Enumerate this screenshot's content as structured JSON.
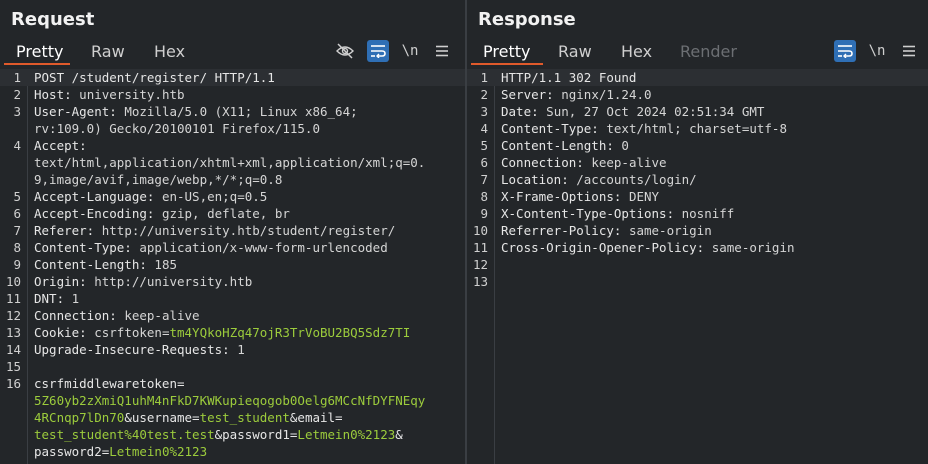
{
  "request": {
    "title": "Request",
    "tabs": [
      "Pretty",
      "Raw",
      "Hex"
    ],
    "lines": [
      {
        "n": "1",
        "k": "POST /student/register/ HTTP/1.1",
        "v": ""
      },
      {
        "n": "2",
        "k": "Host:",
        "v": " university.htb"
      },
      {
        "n": "3",
        "k": "User-Agent:",
        "v": " Mozilla/5.0 (X11; Linux x86_64;"
      },
      {
        "n": "",
        "k": "",
        "v": "rv:109.0) Gecko/20100101 Firefox/115.0"
      },
      {
        "n": "4",
        "k": "Accept:",
        "v": ""
      },
      {
        "n": "",
        "k": "",
        "v": "text/html,application/xhtml+xml,application/xml;q=0."
      },
      {
        "n": "",
        "k": "",
        "v": "9,image/avif,image/webp,*/*;q=0.8"
      },
      {
        "n": "5",
        "k": "Accept-Language:",
        "v": " en-US,en;q=0.5"
      },
      {
        "n": "6",
        "k": "Accept-Encoding:",
        "v": " gzip, deflate, br"
      },
      {
        "n": "7",
        "k": "Referer:",
        "v": " http://university.htb/student/register/"
      },
      {
        "n": "8",
        "k": "Content-Type:",
        "v": " application/x-www-form-urlencoded"
      },
      {
        "n": "9",
        "k": "Content-Length:",
        "v": " 185"
      },
      {
        "n": "10",
        "k": "Origin:",
        "v": " http://university.htb"
      },
      {
        "n": "11",
        "k": "DNT:",
        "v": " 1"
      },
      {
        "n": "12",
        "k": "Connection:",
        "v": " keep-alive"
      },
      {
        "n": "13",
        "k": "Cookie:",
        "v": " csrftoken=",
        "g": "tm4YQkoHZq47ojR3TrVoBU2BQ5Sdz7TI"
      },
      {
        "n": "14",
        "k": "Upgrade-Insecure-Requests:",
        "v": " 1"
      },
      {
        "n": "15",
        "k": "",
        "v": ""
      },
      {
        "n": "16",
        "k": "",
        "v": ""
      }
    ],
    "body_lines": [
      [
        {
          "t": "csrfmiddlewaretoken=",
          "c": "w"
        }
      ],
      [
        {
          "t": "5Z60yb2zXmiQ1uhM4nFkD7KWKupieqogob0Oelg6MCcNfDYFNEqy",
          "c": "g"
        }
      ],
      [
        {
          "t": "4RCnqp7lDn70",
          "c": "g"
        },
        {
          "t": "&username=",
          "c": "w"
        },
        {
          "t": "test_student",
          "c": "g"
        },
        {
          "t": "&email=",
          "c": "w"
        }
      ],
      [
        {
          "t": "test_student%40test.test",
          "c": "g"
        },
        {
          "t": "&password1=",
          "c": "w"
        },
        {
          "t": "Letmein0%2123",
          "c": "g"
        },
        {
          "t": "&",
          "c": "w"
        }
      ],
      [
        {
          "t": "password2=",
          "c": "w"
        },
        {
          "t": "Letmein0%2123",
          "c": "g"
        }
      ]
    ]
  },
  "response": {
    "title": "Response",
    "tabs": [
      "Pretty",
      "Raw",
      "Hex",
      "Render"
    ],
    "lines": [
      {
        "n": "1",
        "k": "HTTP/1.1 302 Found",
        "v": ""
      },
      {
        "n": "2",
        "k": "Server:",
        "v": " nginx/1.24.0"
      },
      {
        "n": "3",
        "k": "Date:",
        "v": " Sun, 27 Oct 2024 02:51:34 GMT"
      },
      {
        "n": "4",
        "k": "Content-Type:",
        "v": " text/html; charset=utf-8"
      },
      {
        "n": "5",
        "k": "Content-Length:",
        "v": " 0"
      },
      {
        "n": "6",
        "k": "Connection:",
        "v": " keep-alive"
      },
      {
        "n": "7",
        "k": "Location:",
        "v": " /accounts/login/"
      },
      {
        "n": "8",
        "k": "X-Frame-Options:",
        "v": " DENY"
      },
      {
        "n": "9",
        "k": "X-Content-Type-Options:",
        "v": " nosniff"
      },
      {
        "n": "10",
        "k": "Referrer-Policy:",
        "v": " same-origin"
      },
      {
        "n": "11",
        "k": "Cross-Origin-Opener-Policy:",
        "v": " same-origin"
      },
      {
        "n": "12",
        "k": "",
        "v": ""
      },
      {
        "n": "13",
        "k": "",
        "v": ""
      }
    ]
  },
  "icons": {
    "hide": "eye-slash-icon",
    "wrap": "wrap-lines-icon",
    "newline": "\\n",
    "menu": "menu-icon"
  },
  "colors": {
    "accent": "#e05a2b",
    "active_tool": "#2f6fb5",
    "green": "#9ccc3c"
  }
}
